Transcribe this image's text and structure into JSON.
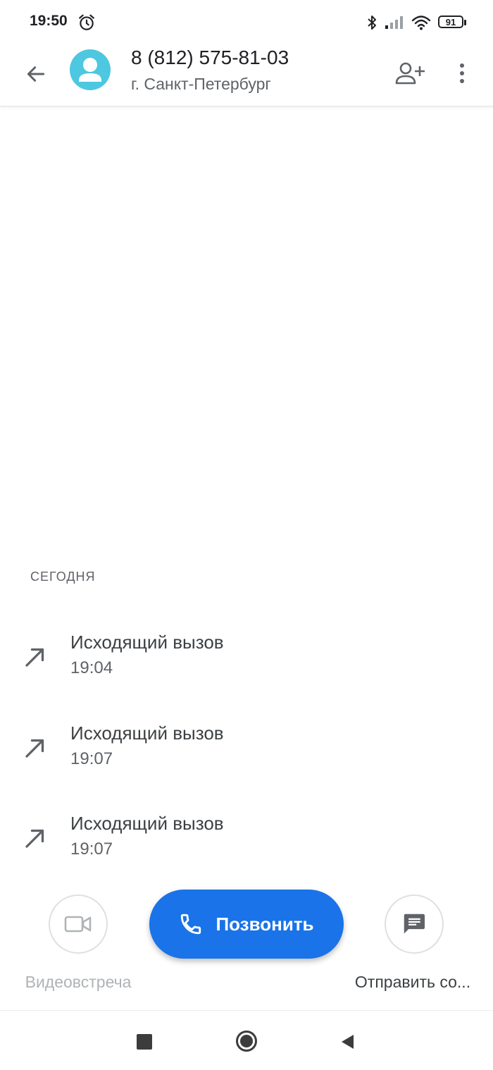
{
  "status_bar": {
    "time": "19:50",
    "battery": "91",
    "icons": [
      "alarm-icon",
      "bluetooth-icon",
      "signal-icon",
      "wifi-icon",
      "battery-icon"
    ]
  },
  "header": {
    "back_icon": "arrow-back-icon",
    "number": "8 (812) 575-81-03",
    "location": "г. Санкт-Петербург",
    "add_contact_icon": "person-add-icon",
    "more_icon": "more-vert-icon"
  },
  "history": {
    "section_label": "СЕГОДНЯ",
    "calls": [
      {
        "type": "Исходящий вызов",
        "time": "19:04",
        "icon": "outgoing-call-arrow-icon"
      },
      {
        "type": "Исходящий вызов",
        "time": "19:07",
        "icon": "outgoing-call-arrow-icon"
      },
      {
        "type": "Исходящий вызов",
        "time": "19:07",
        "icon": "outgoing-call-arrow-icon"
      }
    ]
  },
  "actions": {
    "video_label": "Видеовстреча",
    "call_label": "Позвонить",
    "message_label": "Отправить со...",
    "accent_color": "#1a73e8"
  },
  "nav": {
    "icons": [
      "recents-square-icon",
      "home-circle-icon",
      "back-triangle-icon"
    ]
  }
}
